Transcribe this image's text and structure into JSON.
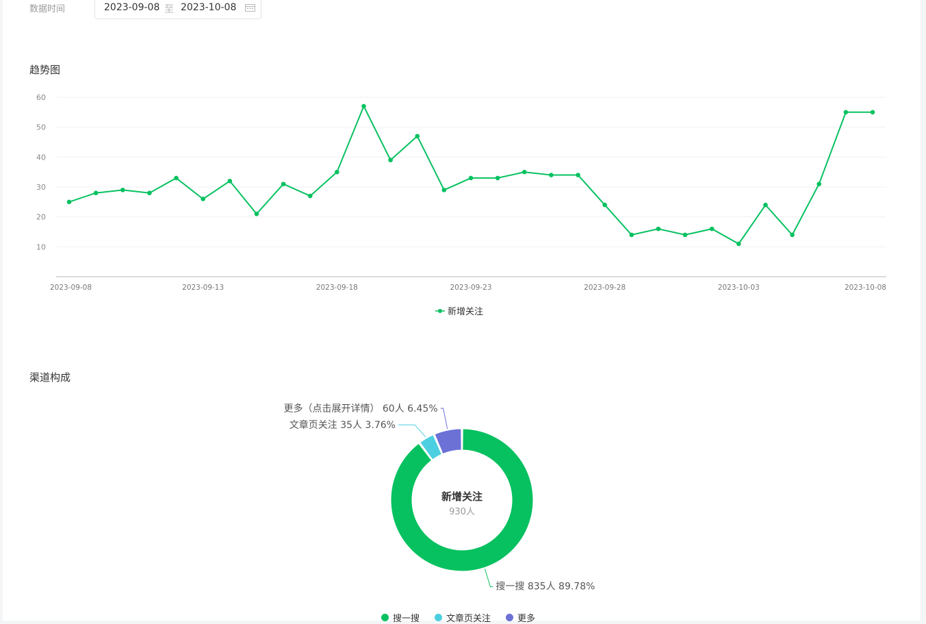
{
  "filter": {
    "label": "数据时间",
    "start": "2023-09-08",
    "separator": "至",
    "end": "2023-10-08"
  },
  "trend_title": "趋势图",
  "channel_title": "渠道构成",
  "colors": {
    "line": "#07c160",
    "green": "#07c160",
    "cyan": "#4ccfe0",
    "purple": "#6c71d6"
  },
  "chart_data": [
    {
      "type": "line",
      "title": "",
      "xlabel": "",
      "ylabel": "",
      "ylim": [
        0,
        60
      ],
      "yticks": [
        10,
        20,
        30,
        40,
        50,
        60
      ],
      "x_tick_labels": [
        "2023-09-08",
        "2023-09-13",
        "2023-09-18",
        "2023-09-23",
        "2023-09-28",
        "2023-10-03",
        "2023-10-08"
      ],
      "grid": true,
      "legend": "bottom-center",
      "x": [
        "2023-09-08",
        "2023-09-09",
        "2023-09-10",
        "2023-09-11",
        "2023-09-12",
        "2023-09-13",
        "2023-09-14",
        "2023-09-15",
        "2023-09-16",
        "2023-09-17",
        "2023-09-18",
        "2023-09-19",
        "2023-09-20",
        "2023-09-21",
        "2023-09-22",
        "2023-09-23",
        "2023-09-24",
        "2023-09-25",
        "2023-09-26",
        "2023-09-27",
        "2023-09-28",
        "2023-09-29",
        "2023-09-30",
        "2023-10-01",
        "2023-10-02",
        "2023-10-03",
        "2023-10-04",
        "2023-10-05",
        "2023-10-06",
        "2023-10-07",
        "2023-10-08"
      ],
      "series": [
        {
          "name": "新增关注",
          "values": [
            25,
            28,
            29,
            28,
            33,
            26,
            32,
            21,
            31,
            27,
            35,
            57,
            39,
            47,
            29,
            33,
            33,
            35,
            34,
            34,
            24,
            14,
            16,
            14,
            16,
            11,
            24,
            14,
            31,
            55,
            55
          ]
        }
      ]
    },
    {
      "type": "pie",
      "title": "",
      "center_title": "新增关注",
      "center_value": "930人",
      "legend": "bottom-center",
      "slices": [
        {
          "name": "搜一搜",
          "value": 835,
          "unit": "人",
          "percent": "89.78%",
          "label": "搜一搜 835人 89.78%",
          "legend": "搜一搜",
          "color": "#07c160"
        },
        {
          "name": "文章页关注",
          "value": 35,
          "unit": "人",
          "percent": "3.76%",
          "label": "文章页关注 35人 3.76%",
          "legend": "文章页关注",
          "color": "#4ccfe0"
        },
        {
          "name": "更多（点击展开详情）",
          "value": 60,
          "unit": "人",
          "percent": "6.45%",
          "label": "更多（点击展开详情） 60人 6.45%",
          "legend": "更多",
          "color": "#6c71d6"
        }
      ]
    }
  ]
}
